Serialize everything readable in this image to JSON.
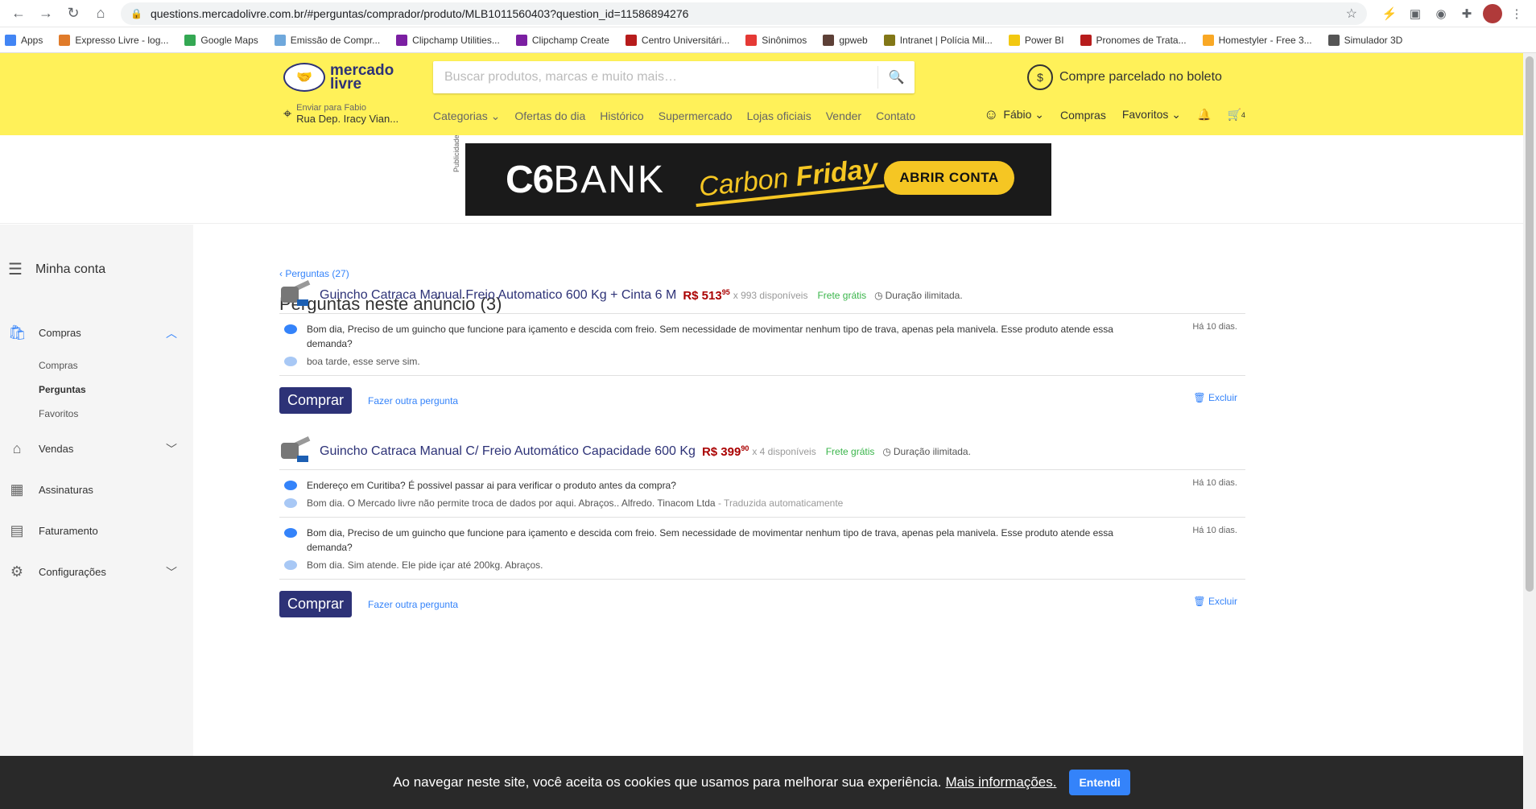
{
  "browser": {
    "url": "questions.mercadolivre.com.br/#perguntas/comprador/produto/MLB1011560403?question_id=11586894276",
    "bookmarks": [
      {
        "label": "Apps",
        "color": "#4285f4"
      },
      {
        "label": "Expresso Livre - log...",
        "color": "#e07b2a"
      },
      {
        "label": "Google Maps",
        "color": "#34a853"
      },
      {
        "label": "Emissão de Compr...",
        "color": "#6fa8dc"
      },
      {
        "label": "Clipchamp Utilities...",
        "color": "#7b1fa2"
      },
      {
        "label": "Clipchamp Create",
        "color": "#7b1fa2"
      },
      {
        "label": "Centro Universitári...",
        "color": "#b71c1c"
      },
      {
        "label": "Sinônimos",
        "color": "#e53935"
      },
      {
        "label": "gpweb",
        "color": "#5d4037"
      },
      {
        "label": "Intranet | Polícia Mil...",
        "color": "#827717"
      },
      {
        "label": "Power BI",
        "color": "#f2c811"
      },
      {
        "label": "Pronomes de Trata...",
        "color": "#b71c1c"
      },
      {
        "label": "Homestyler - Free 3...",
        "color": "#f9a825"
      },
      {
        "label": "Simulador 3D",
        "color": "#555555"
      }
    ]
  },
  "header": {
    "logo_text": "mercado livre",
    "search_placeholder": "Buscar produtos, marcas e muito mais…",
    "promo": "Compre parcelado no boleto",
    "ship_to_label": "Enviar para Fabio",
    "ship_to_address": "Rua Dep. Iracy Vian...",
    "nav": [
      "Categorias ⌄",
      "Ofertas do dia",
      "Histórico",
      "Supermercado",
      "Lojas oficiais",
      "Vender",
      "Contato"
    ],
    "user": "Fábio ⌄",
    "compras": "Compras",
    "favoritos": "Favoritos ⌄",
    "cart_count": "4"
  },
  "banner": {
    "label": "Publicidade",
    "brand_c6": "C6",
    "brand_bank": "BANK",
    "campaign_light": "Carbon ",
    "campaign_bold": "Friday",
    "cta": "ABRIR CONTA"
  },
  "sidebar": {
    "title": "Minha conta",
    "items": [
      {
        "label": "Compras",
        "icon": "bag-icon"
      },
      {
        "label": "Vendas",
        "icon": "store-icon"
      },
      {
        "label": "Assinaturas",
        "icon": "calendar-icon"
      },
      {
        "label": "Faturamento",
        "icon": "receipt-icon"
      },
      {
        "label": "Configurações",
        "icon": "gear-icon"
      }
    ],
    "sub_items": [
      "Compras",
      "Perguntas",
      "Favoritos"
    ]
  },
  "content": {
    "back_link": "Perguntas (27)",
    "title": "Perguntas neste anúncio (3)",
    "products": [
      {
        "title": "Guincho Catraca Manual Freio Automatico 600 Kg + Cinta 6 M",
        "price_int": "R$ 513",
        "price_cents": "95",
        "availability": "x 993 disponíveis",
        "shipping": "Frete grátis",
        "duration": "Duração ilimitada.",
        "questions": [
          {
            "q": "Bom dia, Preciso de um guincho que funcione para içamento e descida com freio. Sem necessidade de movimentar nenhum tipo de trava, apenas pela manivela. Esse produto atende essa demanda?",
            "a": "boa tarde, esse serve sim.",
            "a_auto": "",
            "time": "Há 10 dias."
          }
        ]
      },
      {
        "title": "Guincho Catraca Manual C/ Freio Automático Capacidade 600 Kg",
        "price_int": "R$ 399",
        "price_cents": "90",
        "availability": "x 4 disponíveis",
        "shipping": "Frete grátis",
        "duration": "Duração ilimitada.",
        "questions": [
          {
            "q": "Endereço em Curitiba? É possivel passar ai para verificar o produto antes da compra?",
            "a": "Bom dia. O Mercado livre não permite troca de dados por aqui. Abraços.. Alfredo. Tinacom Ltda",
            "a_auto": " - Traduzida automaticamente",
            "time": "Há 10 dias."
          },
          {
            "q": "Bom dia, Preciso de um guincho que funcione para içamento e descida com freio. Sem necessidade de movimentar nenhum tipo de trava, apenas pela manivela. Esse produto atende essa demanda?",
            "a": "Bom dia. Sim atende. Ele pide içar até 200kg. Abraços.",
            "a_auto": "",
            "time": "Há 10 dias."
          }
        ]
      }
    ],
    "buy_label": "Comprar",
    "ask_label": "Fazer outra pergunta",
    "delete_label": "Excluir"
  },
  "cookie": {
    "text": "Ao navegar neste site, você aceita os cookies que usamos para melhorar sua experiência.",
    "link": "Mais informações.",
    "button": "Entendi"
  },
  "colors": {
    "header_yellow": "#fff159",
    "brand_blue": "#2d3277",
    "link_blue": "#3483fa",
    "price_red": "#a00000",
    "free_shipping_green": "#39b54a"
  }
}
